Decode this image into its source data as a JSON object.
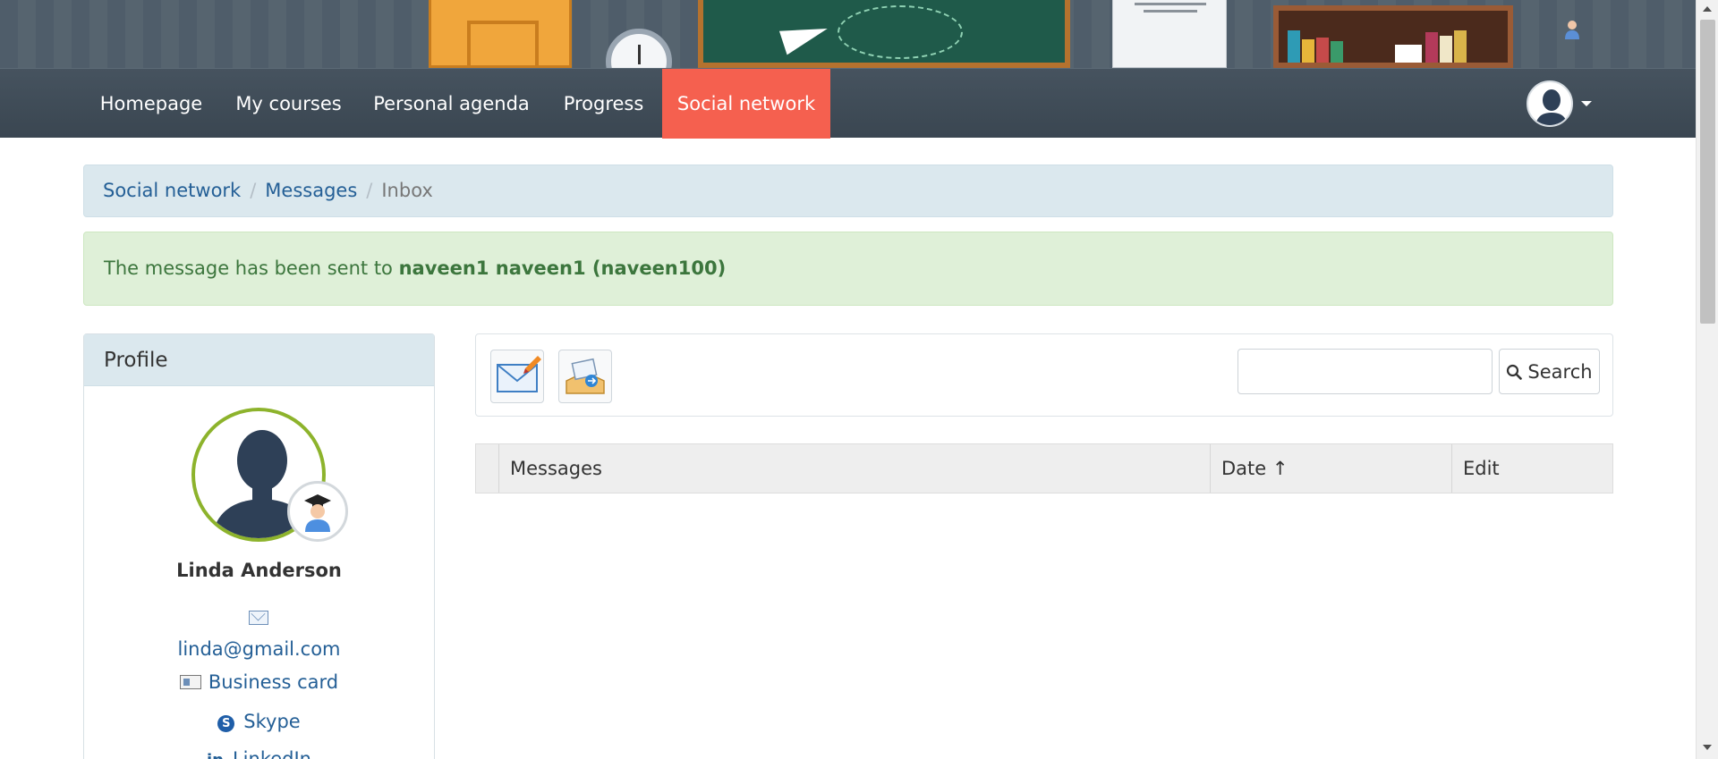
{
  "nav": {
    "items": [
      {
        "label": "Homepage"
      },
      {
        "label": "My courses"
      },
      {
        "label": "Personal agenda"
      },
      {
        "label": "Progress"
      },
      {
        "label": "Social network"
      }
    ],
    "active": "Social network"
  },
  "breadcrumb": {
    "items": [
      "Social network",
      "Messages"
    ],
    "current": "Inbox"
  },
  "alert": {
    "text": "The message has been sent to ",
    "bold": "naveen1 naveen1 (naveen100)"
  },
  "profile": {
    "heading": "Profile",
    "name": "Linda Anderson",
    "email": "linda@gmail.com",
    "business_card": "Business card",
    "skype": "Skype",
    "linkedin": "LinkedIn"
  },
  "toolbar": {
    "compose_icon": "compose-mail-icon",
    "outbox_icon": "outbox-icon",
    "search_value": "",
    "search_label": "Search"
  },
  "table": {
    "columns": [
      "Messages",
      "Date ↑",
      "Edit"
    ]
  },
  "colors": {
    "nav_active": "#f5604f",
    "link": "#245f96",
    "alert_text": "#3c763d",
    "alert_bg": "#dff0d8",
    "avatar_ring": "#8db32c"
  }
}
